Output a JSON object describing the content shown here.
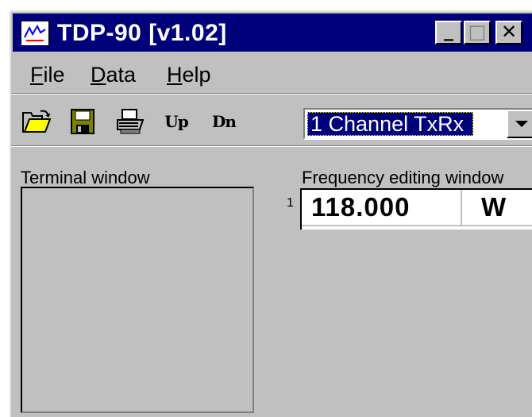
{
  "window": {
    "title": "TDP-90 [v1.02]",
    "controls": {
      "minimize": "_",
      "maximize": "□",
      "close": "✕"
    }
  },
  "menu": {
    "items": [
      {
        "underline": "F",
        "rest": "ile"
      },
      {
        "underline": "D",
        "rest": "ata"
      },
      {
        "underline": "H",
        "rest": "elp"
      }
    ]
  },
  "toolbar": {
    "tools": [
      {
        "icon": "open-folder-icon"
      },
      {
        "icon": "save-disk-icon"
      },
      {
        "icon": "printer-icon"
      },
      {
        "icon": "upload-icon",
        "label": "Up"
      },
      {
        "icon": "download-icon",
        "label": "Dn"
      }
    ],
    "channel_select": {
      "value": "1 Channel TxRx"
    }
  },
  "terminal": {
    "label": "Terminal window"
  },
  "frequency": {
    "label": "Frequency editing window",
    "rows": [
      {
        "number": "1",
        "frequency": "118.000",
        "mode": "W"
      }
    ]
  },
  "colors": {
    "titlebar": "#00007b",
    "face": "#c0c0c0",
    "selection": "#00007b",
    "folder_yellow": "#ffff00",
    "disk_olive": "#808000"
  }
}
